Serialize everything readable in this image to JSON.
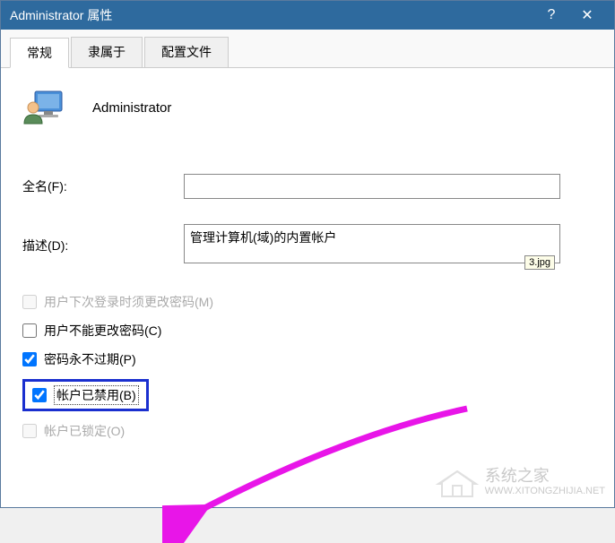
{
  "titlebar": {
    "title": "Administrator 属性",
    "help": "?",
    "close": "✕"
  },
  "tabs": {
    "general": "常规",
    "member_of": "隶属于",
    "profile": "配置文件"
  },
  "user": {
    "name": "Administrator"
  },
  "form": {
    "fullname_label": "全名(F):",
    "fullname_value": "",
    "description_label": "描述(D):",
    "description_value": "管理计算机(域)的内置帐户",
    "jpg_badge": "3.jpg"
  },
  "checkboxes": {
    "must_change_label": "用户下次登录时须更改密码(M)",
    "cannot_change_label": "用户不能更改密码(C)",
    "never_expires_label": "密码永不过期(P)",
    "disabled_label": "帐户已禁用(B)",
    "locked_label": "帐户已锁定(O)"
  },
  "watermark": {
    "name": "系统之家",
    "url": "WWW.XITONGZHIJIA.NET"
  }
}
